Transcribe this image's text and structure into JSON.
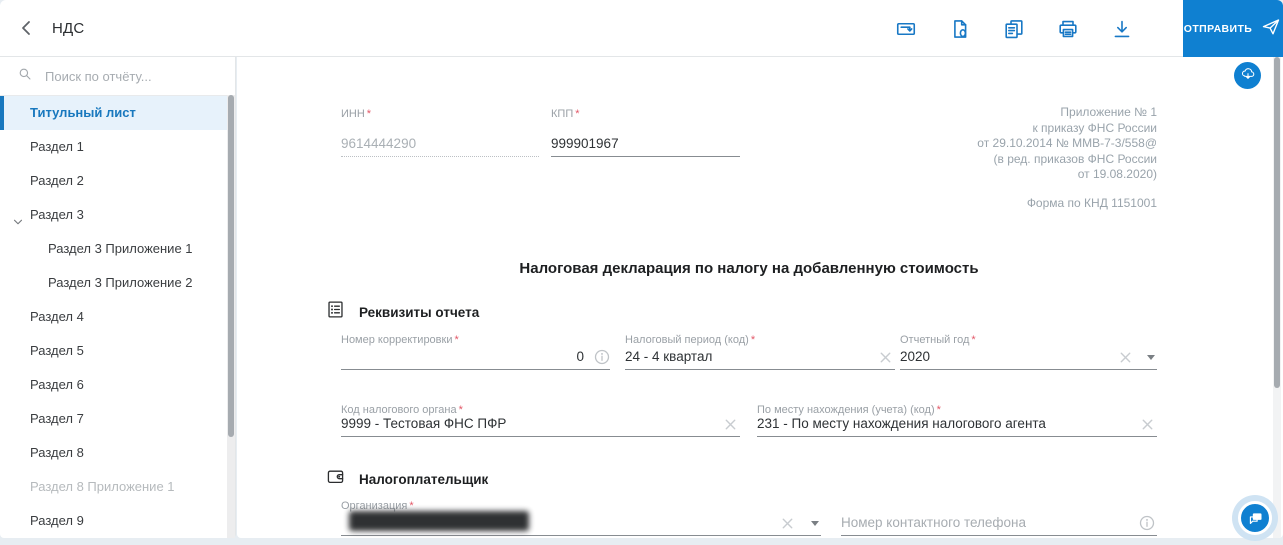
{
  "header": {
    "title": "НДС",
    "send_button_label": "ОТПРАВИТЬ",
    "toolbar_icons": [
      {
        "name": "move-to-archive"
      },
      {
        "name": "nullify-report"
      },
      {
        "name": "copy-report"
      },
      {
        "name": "print"
      },
      {
        "name": "download"
      }
    ]
  },
  "sidebar": {
    "search_placeholder": "Поиск по отчёту...",
    "items": [
      {
        "label": "Титульный лист",
        "state": "active"
      },
      {
        "label": "Раздел 1"
      },
      {
        "label": "Раздел 2"
      },
      {
        "label": "Раздел 3",
        "expanded": true
      },
      {
        "label": "Раздел 3 Приложение 1",
        "child": true
      },
      {
        "label": "Раздел 3 Приложение 2",
        "child": true
      },
      {
        "label": "Раздел 4"
      },
      {
        "label": "Раздел 5"
      },
      {
        "label": "Раздел 6"
      },
      {
        "label": "Раздел 7"
      },
      {
        "label": "Раздел 8"
      },
      {
        "label": "Раздел 8 Приложение 1",
        "state": "disabled"
      },
      {
        "label": "Раздел 9"
      }
    ]
  },
  "ui": {
    "required_marker": "*"
  },
  "form": {
    "legal_note": [
      "Приложение № 1",
      "к приказу ФНС России",
      "от 29.10.2014 № ММВ-7-3/558@",
      "(в ред. приказов ФНС России",
      "от 19.08.2020)"
    ],
    "form_code": "Форма по КНД 1151001",
    "title": "Налоговая декларация по налогу на добавленную стоимость",
    "inn": {
      "label": "ИНН",
      "value": "9614444290",
      "disabled": true
    },
    "kpp": {
      "label": "КПП",
      "value": "999901967"
    },
    "requisites": {
      "section_title": "Реквизиты отчета",
      "correction_number": {
        "label": "Номер корректировки",
        "value": "0"
      },
      "tax_period": {
        "label": "Налоговый период (код)",
        "value": "24 - 4 квартал"
      },
      "report_year": {
        "label": "Отчетный год",
        "value": "2020"
      },
      "tax_authority": {
        "label": "Код налогового органа",
        "value": "9999 - Тестовая ФНС ПФР"
      },
      "location_code": {
        "label": "По месту нахождения (учета) (код)",
        "value": "231 - По месту нахождения налогового агента"
      }
    },
    "taxpayer": {
      "section_title": "Налогоплательщик",
      "organization": {
        "label": "Организация",
        "value_redacted": true
      },
      "phone": {
        "label": "Номер контактного телефона",
        "value": ""
      }
    }
  },
  "colors": {
    "accent": "#0f80d1",
    "active_item": "#1878be",
    "required": "#e25767"
  }
}
